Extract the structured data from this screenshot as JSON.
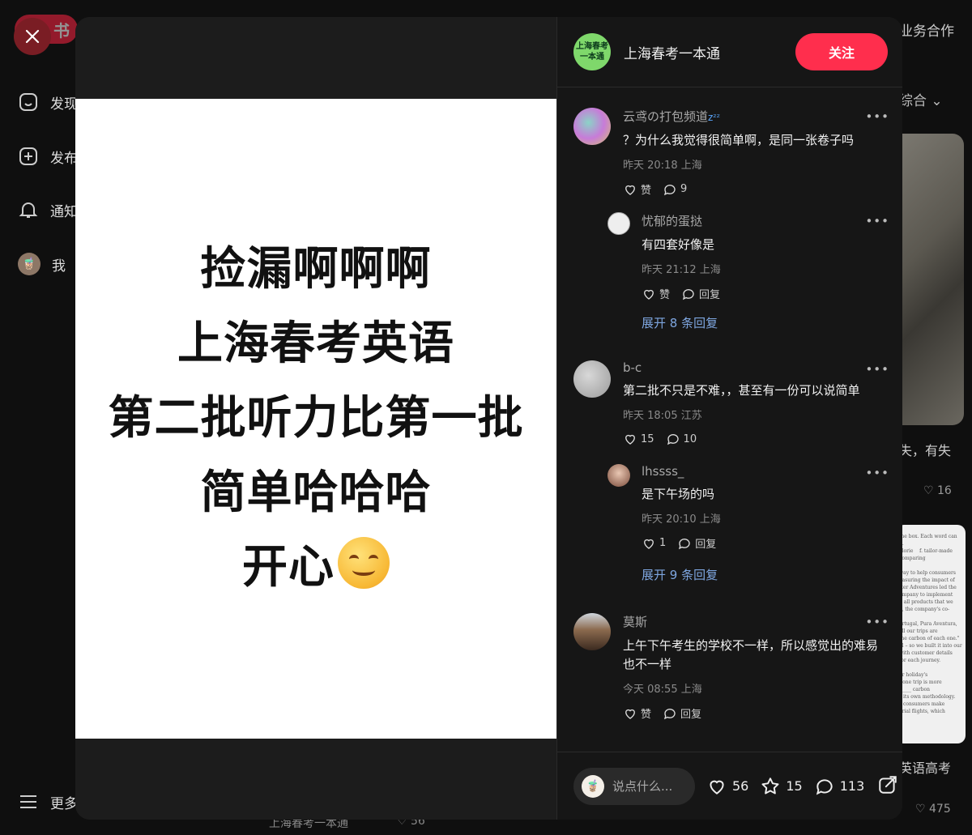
{
  "background": {
    "logo_text": "书",
    "nav": [
      {
        "label": "发现",
        "icon": "home-icon"
      },
      {
        "label": "发布",
        "icon": "plus-square-icon"
      },
      {
        "label": "通知",
        "icon": "bell-icon"
      },
      {
        "label": "我",
        "icon": "avatar"
      }
    ],
    "more_label": "更多",
    "top_right": "业务合作",
    "sort_label": "综合",
    "card1_text": "失，有失",
    "card1_likes": "16",
    "card2_text": "英语高考",
    "card2_likes": "475",
    "bottom_author": "上海春考一本通",
    "bottom_likes": "56"
  },
  "note": {
    "lines": [
      "捡漏啊啊啊",
      "上海春考英语",
      "第二批听力比第一批",
      "简单哈哈哈",
      "开心"
    ]
  },
  "author": {
    "avatar_line1": "上海春考",
    "avatar_line2": "一本通",
    "name": "上海春考一本通",
    "follow_label": "关注"
  },
  "comments": [
    {
      "name": "云鸢の打包频道",
      "text": "？为什么我觉得很简单啊，是同一张卷子吗",
      "time": "昨天 20:18 上海",
      "like": "赞",
      "reply": "9"
    },
    {
      "name": "忧郁的蛋挞",
      "text": "有四套好像是",
      "time": "昨天 21:12 上海",
      "like": "赞",
      "reply": "回复"
    },
    {
      "expand": "展开 8 条回复"
    },
    {
      "name": "b-c",
      "text": "第二批不只是不难，，甚至有一份可以说简单",
      "time": "昨天 18:05 江苏",
      "like": "15",
      "reply": "10"
    },
    {
      "name": "lhssss_",
      "text": "是下午场的吗",
      "time": "昨天 20:10 上海",
      "like": "1",
      "reply": "回复"
    },
    {
      "expand": "展开 9 条回复"
    },
    {
      "name": "莫斯",
      "text": "上午下午考生的学校不一样，所以感觉出的难易也不一样",
      "time": "今天 08:55 上海",
      "like": "赞",
      "reply": "回复"
    }
  ],
  "bottom": {
    "placeholder": "说点什么...",
    "likes": "56",
    "collects": "15",
    "comments": "113"
  },
  "colors": {
    "accent": "#ff2e4d",
    "link": "#7ea6e0",
    "panel": "#161616"
  }
}
